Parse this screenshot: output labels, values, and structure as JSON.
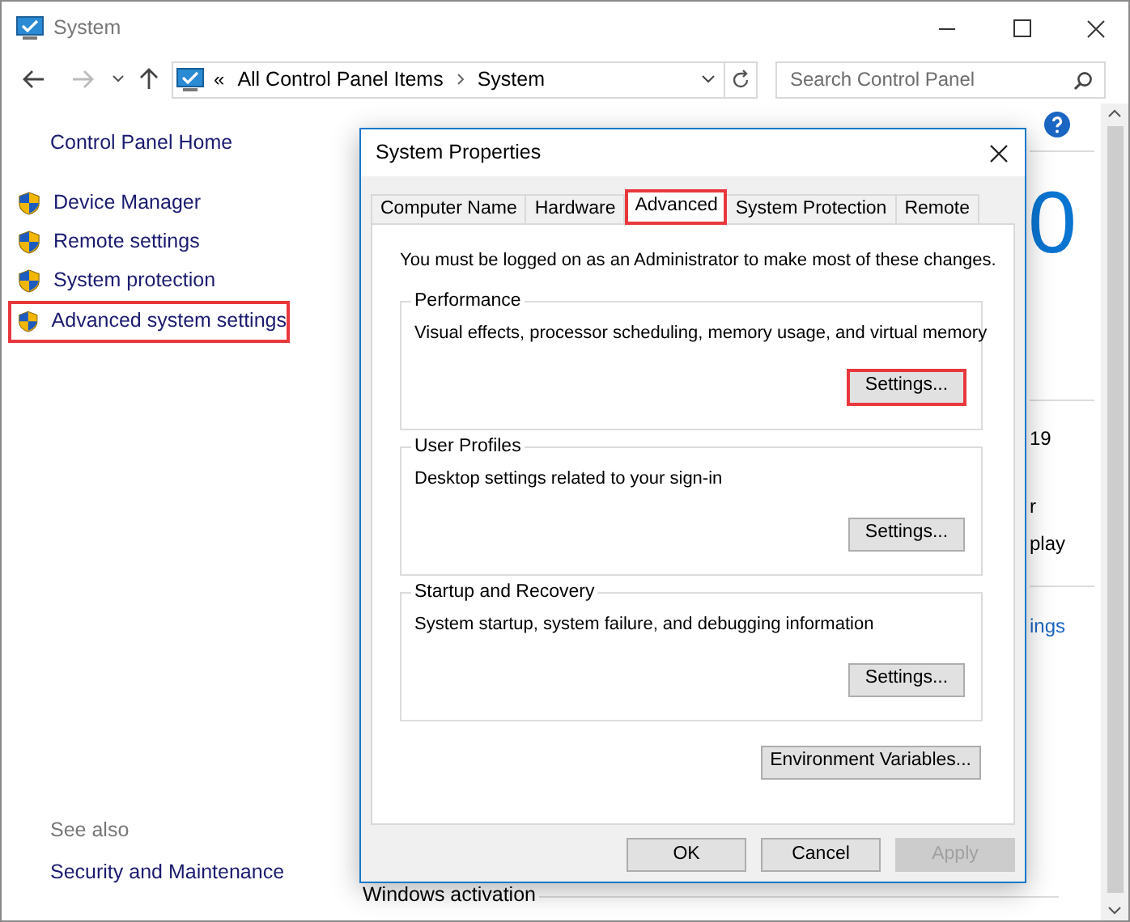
{
  "window": {
    "title": "System"
  },
  "address_bar": {
    "prefix": "«",
    "segments": [
      "All Control Panel Items",
      "System"
    ]
  },
  "search": {
    "placeholder": "Search Control Panel"
  },
  "sidebar": {
    "home": "Control Panel Home",
    "items": [
      {
        "label": "Device Manager",
        "highlighted": false
      },
      {
        "label": "Remote settings",
        "highlighted": false
      },
      {
        "label": "System protection",
        "highlighted": false
      },
      {
        "label": "Advanced system settings",
        "highlighted": true
      }
    ],
    "see_also": {
      "heading": "See also",
      "links": [
        "Security and Maintenance"
      ]
    }
  },
  "background_content": {
    "logo_fragment": "0",
    "version_fragment": "19",
    "text_fragments": [
      "r",
      "play"
    ],
    "link_fragment": "ings",
    "section_heading": "Windows activation"
  },
  "dialog": {
    "title": "System Properties",
    "tabs": [
      {
        "label": "Computer Name",
        "selected": false,
        "highlighted": false
      },
      {
        "label": "Hardware",
        "selected": false,
        "highlighted": false
      },
      {
        "label": "Advanced",
        "selected": true,
        "highlighted": true
      },
      {
        "label": "System Protection",
        "selected": false,
        "highlighted": false
      },
      {
        "label": "Remote",
        "selected": false,
        "highlighted": false
      }
    ],
    "notice": "You must be logged on as an Administrator to make most of these changes.",
    "groups": [
      {
        "title": "Performance",
        "description": "Visual effects, processor scheduling, memory usage, and virtual memory",
        "button": {
          "label": "Settings...",
          "highlighted": true
        }
      },
      {
        "title": "User Profiles",
        "description": "Desktop settings related to your sign-in",
        "button": {
          "label": "Settings...",
          "highlighted": false
        }
      },
      {
        "title": "Startup and Recovery",
        "description": "System startup, system failure, and debugging information",
        "button": {
          "label": "Settings...",
          "highlighted": false
        }
      }
    ],
    "environment_button": "Environment Variables...",
    "buttons": [
      {
        "label": "OK",
        "disabled": false
      },
      {
        "label": "Cancel",
        "disabled": false
      },
      {
        "label": "Apply",
        "disabled": true
      }
    ]
  }
}
